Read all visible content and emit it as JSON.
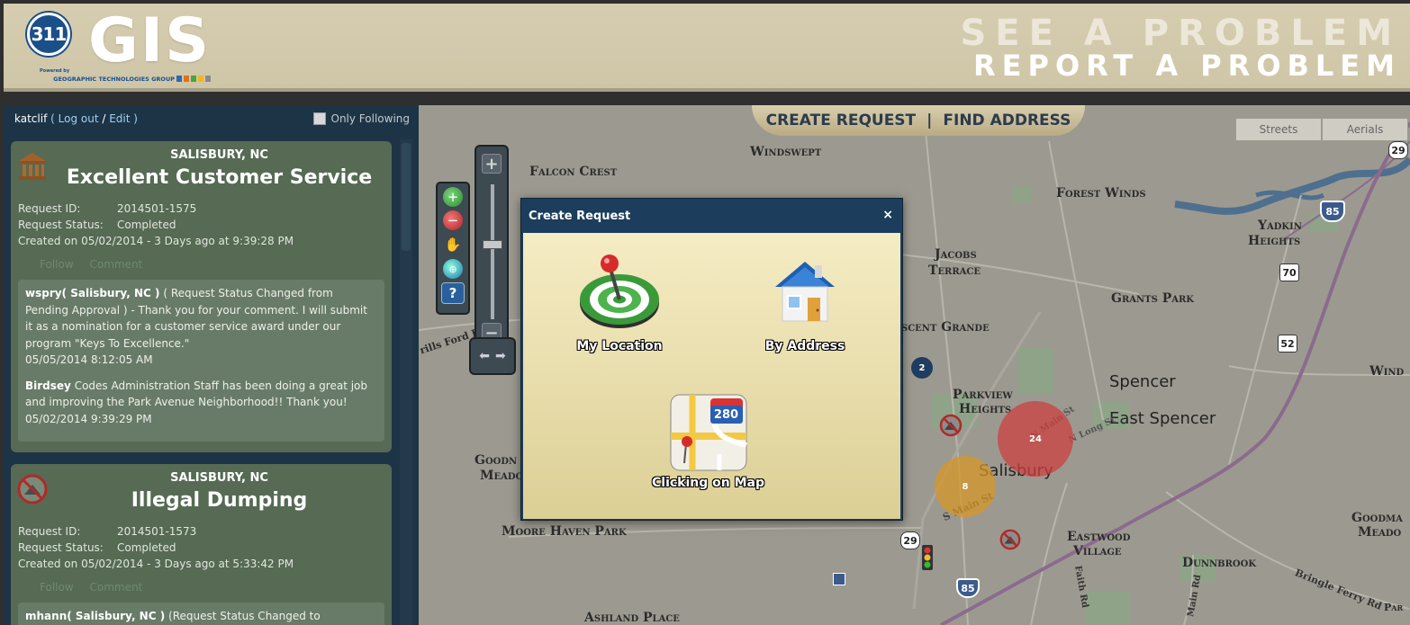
{
  "header": {
    "logo_number": "311",
    "logo_text": "GIS",
    "powered_by": "Powered by",
    "company": "GEOGRAPHIC TECHNOLOGIES GROUP",
    "slogan_line1": "SEE A PROBLEM",
    "slogan_line2": "REPORT A PROBLEM",
    "logo_square_colors": [
      "#2a6bb5",
      "#e0701e",
      "#49a43a",
      "#f1b71c",
      "#8a8a8a"
    ]
  },
  "sidebar": {
    "username": "katclif",
    "logout_label": "Log out",
    "edit_label": "Edit",
    "only_following_label": "Only Following",
    "requests": [
      {
        "icon": "courthouse-icon",
        "city": "SALISBURY, NC",
        "title": "Excellent Customer Service",
        "request_id_label": "Request ID:",
        "request_id": "2014501-1575",
        "status_label": "Request Status:",
        "status": "Completed",
        "created": "Created on 05/02/2014 - 3 Days ago at 9:39:28 PM",
        "follow_label": "Follow",
        "comment_label": "Comment",
        "comments": [
          {
            "author": "wspry( Salisbury, NC )",
            "text": " ( Request Status Changed from Pending Approval ) - Thank you for your comment. I will submit it as a nomination for a customer service award under our program \"Keys To Excellence.\"",
            "date": "05/05/2014  8:12:05 AM"
          },
          {
            "author": "Birdsey",
            "text": " Codes Administration Staff has been doing a great job and improving the Park Avenue Neighborhood!!   Thank you!",
            "date": "05/02/2014  9:39:29 PM"
          }
        ]
      },
      {
        "icon": "no-dumping-icon",
        "city": "SALISBURY, NC",
        "title": "Illegal Dumping",
        "request_id_label": "Request ID:",
        "request_id": "2014501-1573",
        "status_label": "Request Status:",
        "status": "Completed",
        "created": "Created on 05/02/2014 - 3 Days ago at 5:33:42 PM",
        "follow_label": "Follow",
        "comment_label": "Comment",
        "comments": [
          {
            "author": "mhann( Salisbury, NC )",
            "text": " (Request Status Changed to",
            "date": ""
          }
        ]
      }
    ]
  },
  "map": {
    "create_request_label": "CREATE REQUEST",
    "find_address_label": "FIND ADDRESS",
    "separator": "|",
    "basemap_streets": "Streets",
    "basemap_aerials": "Aerials",
    "labels": {
      "windswept": "Windswept",
      "falcon_crest": "Falcon Crest",
      "forest_winds": "Forest Winds",
      "yadkin_heights_1": "Yadkin",
      "yadkin_heights_2": "Heights",
      "jacobs_terrace_1": "Jacobs",
      "jacobs_terrace_2": "Terrace",
      "grants_park": "Grants Park",
      "crescent_grande": "scent Grande",
      "parkview_heights_1": "Parkview",
      "parkview_heights_2": "Heights",
      "spencer": "Spencer",
      "east_spencer": "East Spencer",
      "salisbury": "Salisbury",
      "moore_haven_park": "Moore Haven Park",
      "eastwood_village_1": "Eastwood",
      "eastwood_village_2": "Village",
      "dunnbrook": "Dunnbrook",
      "goodman_1": "Goodma",
      "goodman_2": "Meado",
      "goodn_1": "Goodn",
      "goodn_2": "Meado",
      "ashland_place": "Ashland Place",
      "wind": "Wind",
      "mills_ford": "rills Ford R",
      "n_main_st": "N Main St",
      "n_long_st": "N Long St",
      "s_main_st": "S Main St",
      "bringle_ferry": "Bringle Ferry Rd",
      "faith_rd": "Faith Rd",
      "main_rd": "Main Rd",
      "par": "Par"
    },
    "shields": {
      "i85_top": "85",
      "us29_top": "29",
      "route70": "70",
      "route52": "52",
      "us29_bottom": "29",
      "i85_bottom": "85"
    },
    "clusters": {
      "c2": "2",
      "c24": "24",
      "c8": "8"
    }
  },
  "modal": {
    "title": "Create Request",
    "close": "×",
    "option_my_location": "My Location",
    "option_by_address": "By Address",
    "option_clicking_map": "Clicking on Map",
    "map_icon_badge": "280"
  }
}
